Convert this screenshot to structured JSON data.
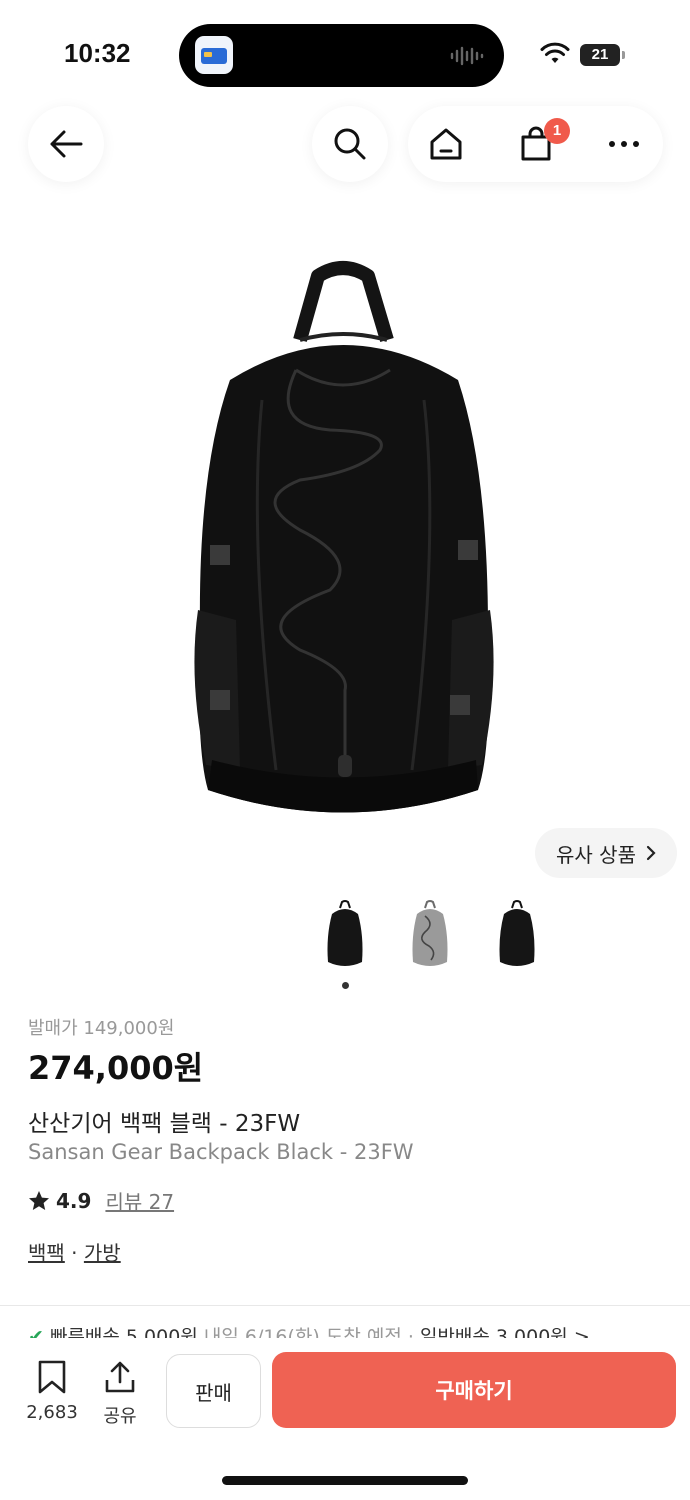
{
  "status": {
    "time": "10:32",
    "battery": "21"
  },
  "nav": {
    "cart_count": "1"
  },
  "hero": {
    "similar_label": "유사 상품"
  },
  "product": {
    "release_price": "발매가 149,000원",
    "price": "274,000원",
    "name_ko": "산산기어 백팩 블랙 - 23FW",
    "name_en": "Sansan Gear Backpack Black - 23FW",
    "rating": "4.9",
    "reviews": "리뷰 27",
    "category1": "백팩",
    "category_sep": " · ",
    "category2": "가방"
  },
  "delivery": {
    "fast": "빠른배송 5,000원",
    "eta": " 내일 6/16(화) 도착 예정",
    "sep": "  ·  ",
    "normal": "일반배송 3,000원 >"
  },
  "actions": {
    "bookmark_count": "2,683",
    "share_label": "공유",
    "sell_label": "판매",
    "buy_label": "구매하기"
  },
  "colors": {
    "accent": "#ef6253",
    "badge": "#f05a4b",
    "delivery_green": "#27a658"
  }
}
